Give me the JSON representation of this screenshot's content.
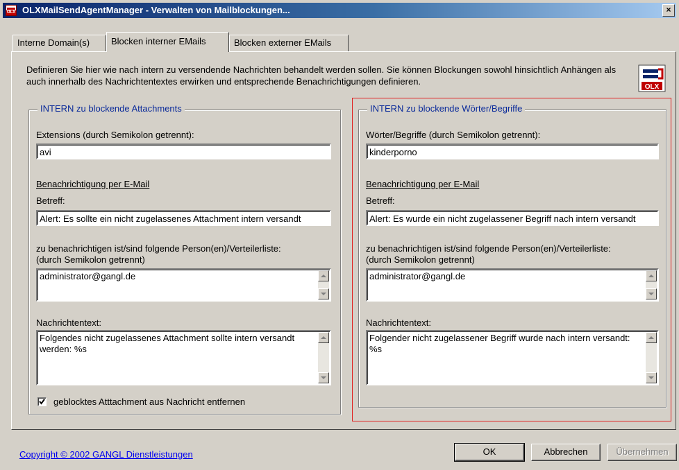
{
  "window": {
    "title": "OLXMailSendAgentManager - Verwalten von Mailblockungen...",
    "close_glyph": "×"
  },
  "tabs": [
    {
      "label": "Interne Domain(s)",
      "active": false
    },
    {
      "label": "Blocken interner EMails",
      "active": true
    },
    {
      "label": "Blocken externer EMails",
      "active": false
    }
  ],
  "description": "Definieren Sie hier wie nach intern zu versendende Nachrichten behandelt werden sollen. Sie können Blockungen sowohl hinsichtlich Anhängen als auch innerhalb des Nachrichtentextes erwirken und entsprechende Benachrichtigungen definieren.",
  "logo": {
    "text": "OLX",
    "color": "#c00000"
  },
  "attachments_group": {
    "title": "INTERN zu blockende Attachments",
    "extensions_label": "Extensions (durch Semikolon getrennt):",
    "extensions_value": "avi",
    "notify_heading": "Benachrichtigung per E-Mail",
    "subject_label": "Betreff:",
    "subject_value": "Alert: Es sollte ein nicht zugelassenes Attachment intern versandt",
    "recipients_label_1": "zu benachrichtigen ist/sind folgende Person(en)/Verteilerliste:",
    "recipients_label_2": "(durch Semikolon getrennt)",
    "recipients_value": "administrator@gangl.de",
    "message_label": "Nachrichtentext:",
    "message_value": "Folgendes nicht zugelassenes Attachment sollte intern versandt werden: %s",
    "remove_checkbox_label": "geblocktes Atttachment aus Nachricht entfernen",
    "remove_checked": true
  },
  "words_group": {
    "title": "INTERN zu blockende Wörter/Begriffe",
    "words_label": "Wörter/Begriffe (durch Semikolon getrennt):",
    "words_value": "kinderporno",
    "notify_heading": "Benachrichtigung per E-Mail",
    "subject_label": "Betreff:",
    "subject_value": "Alert: Es wurde ein nicht zugelassener Begriff nach intern versandt",
    "recipients_label_1": "zu benachrichtigen ist/sind folgende Person(en)/Verteilerliste:",
    "recipients_label_2": "(durch Semikolon getrennt)",
    "recipients_value": "administrator@gangl.de",
    "message_label": "Nachrichtentext:",
    "message_value": "Folgender nicht zugelassener Begriff wurde nach intern versandt: %s"
  },
  "footer": {
    "copyright": "Copyright © 2002 GANGL Dienstleistungen",
    "ok_label": "OK",
    "cancel_label": "Abbrechen",
    "apply_label": "Übernehmen",
    "apply_enabled": false
  },
  "colors": {
    "title_gradient_start": "#0a246a",
    "title_gradient_end": "#a6caf0",
    "face": "#d4d0c8",
    "group_title": "#0a2a9a",
    "highlight_frame": "#e02020",
    "link": "#0000ee"
  }
}
